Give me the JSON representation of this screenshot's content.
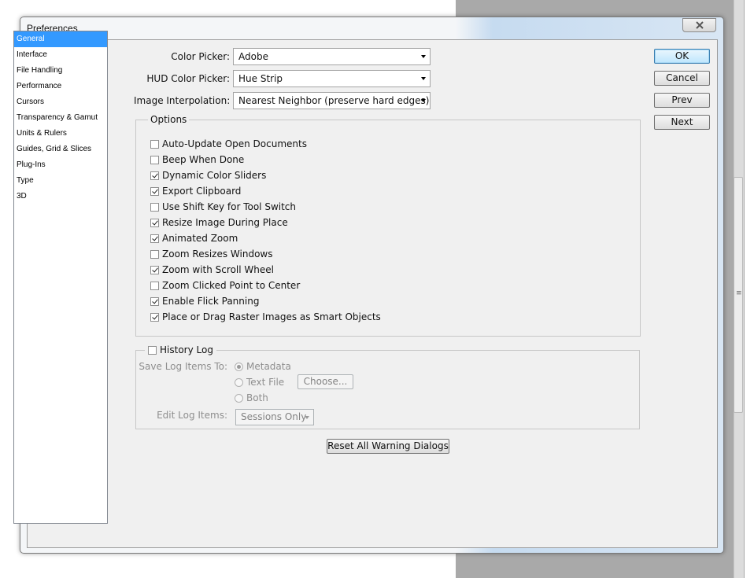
{
  "window": {
    "title": "Preferences"
  },
  "nav": {
    "items": [
      "General",
      "Interface",
      "File Handling",
      "Performance",
      "Cursors",
      "Transparency & Gamut",
      "Units & Rulers",
      "Guides, Grid & Slices",
      "Plug-Ins",
      "Type",
      "3D"
    ],
    "selected": "General"
  },
  "fields": {
    "color_picker": {
      "label": "Color Picker:",
      "value": "Adobe"
    },
    "hud_color_picker": {
      "label": "HUD Color Picker:",
      "value": "Hue Strip"
    },
    "image_interpolation": {
      "label": "Image Interpolation:",
      "value": "Nearest Neighbor (preserve hard edges)"
    }
  },
  "options": {
    "title": "Options",
    "items": [
      {
        "label": "Auto-Update Open Documents",
        "checked": false
      },
      {
        "label": "Beep When Done",
        "checked": false
      },
      {
        "label": "Dynamic Color Sliders",
        "checked": true
      },
      {
        "label": "Export Clipboard",
        "checked": true
      },
      {
        "label": "Use Shift Key for Tool Switch",
        "checked": false
      },
      {
        "label": "Resize Image During Place",
        "checked": true
      },
      {
        "label": "Animated Zoom",
        "checked": true
      },
      {
        "label": "Zoom Resizes Windows",
        "checked": false
      },
      {
        "label": "Zoom with Scroll Wheel",
        "checked": true
      },
      {
        "label": "Zoom Clicked Point to Center",
        "checked": false
      },
      {
        "label": "Enable Flick Panning",
        "checked": true
      },
      {
        "label": "Place or Drag Raster Images as Smart Objects",
        "checked": true
      }
    ]
  },
  "history_log": {
    "title": "History Log",
    "enabled": false,
    "save_to_label": "Save Log Items To:",
    "radio": {
      "metadata": "Metadata",
      "text_file": "Text File",
      "both": "Both",
      "selected": "Metadata"
    },
    "choose_label": "Choose...",
    "edit_label": "Edit Log Items:",
    "edit_value": "Sessions Only"
  },
  "buttons": {
    "ok": "OK",
    "cancel": "Cancel",
    "prev": "Prev",
    "next": "Next",
    "reset": "Reset All Warning Dialogs"
  },
  "colors": {
    "selection": "#3399ff",
    "dialog_bg": "#f0f0f0"
  }
}
